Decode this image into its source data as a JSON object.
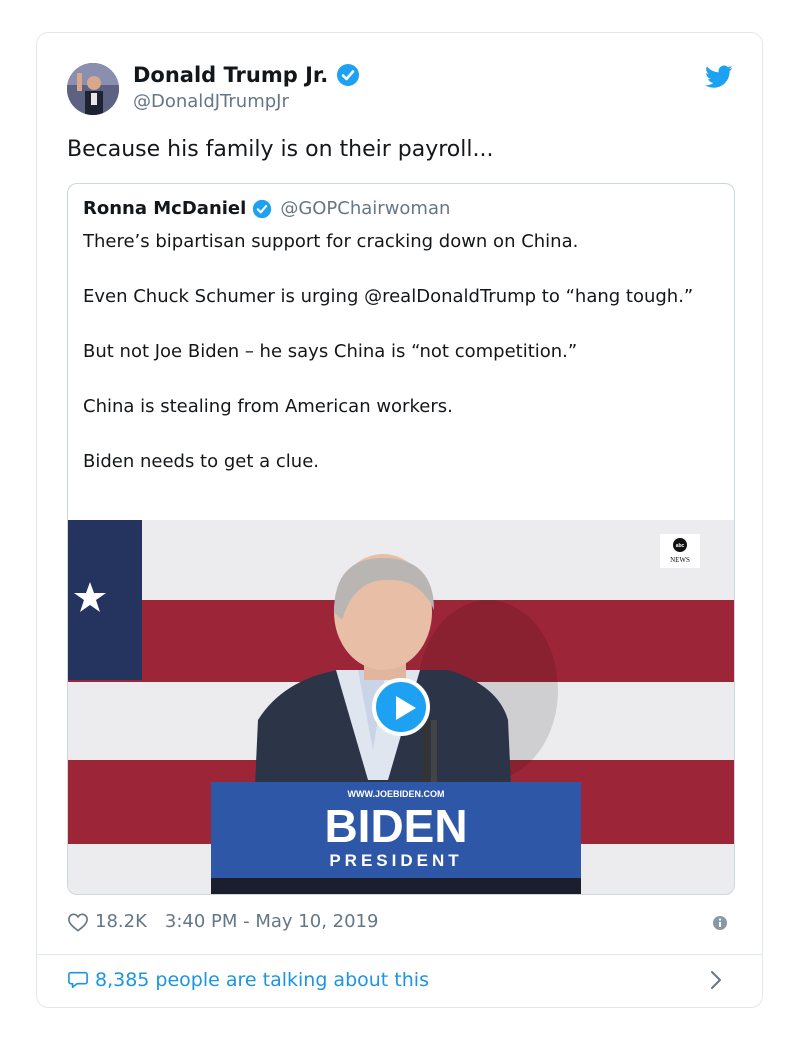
{
  "tweet": {
    "author_name": "Donald Trump Jr.",
    "author_handle": "@DonaldJTrumpJr",
    "text": "Because his family is on their payroll...",
    "likes": "18.2K",
    "timestamp": "3:40 PM - May 10, 2019",
    "talking": "8,385 people are talking about this"
  },
  "quote": {
    "author_name": "Ronna McDaniel",
    "author_handle": "@GOPChairwoman",
    "paragraphs": [
      "There’s bipartisan support for cracking down on China.",
      "Even Chuck Schumer is urging @realDonaldTrump to “hang tough.”",
      "But not Joe Biden – he says China is “not competition.”",
      "China is stealing from American workers.",
      "Biden needs to get a clue."
    ]
  },
  "video": {
    "network_logo": "abc",
    "network_label": "NEWS",
    "podium_url": "WWW.JOEBIDEN.COM",
    "podium_name": "BIDEN",
    "podium_sub": "PRESIDENT"
  },
  "icons": {
    "verified": "verified-badge-icon",
    "twitter": "twitter-bird-icon",
    "like": "heart-icon",
    "info": "info-icon",
    "comment": "comment-icon",
    "chevron": "chevron-right-icon"
  },
  "colors": {
    "twitter_blue": "#1da1f2",
    "link_blue": "#1b95e0",
    "gray": "#657786"
  }
}
